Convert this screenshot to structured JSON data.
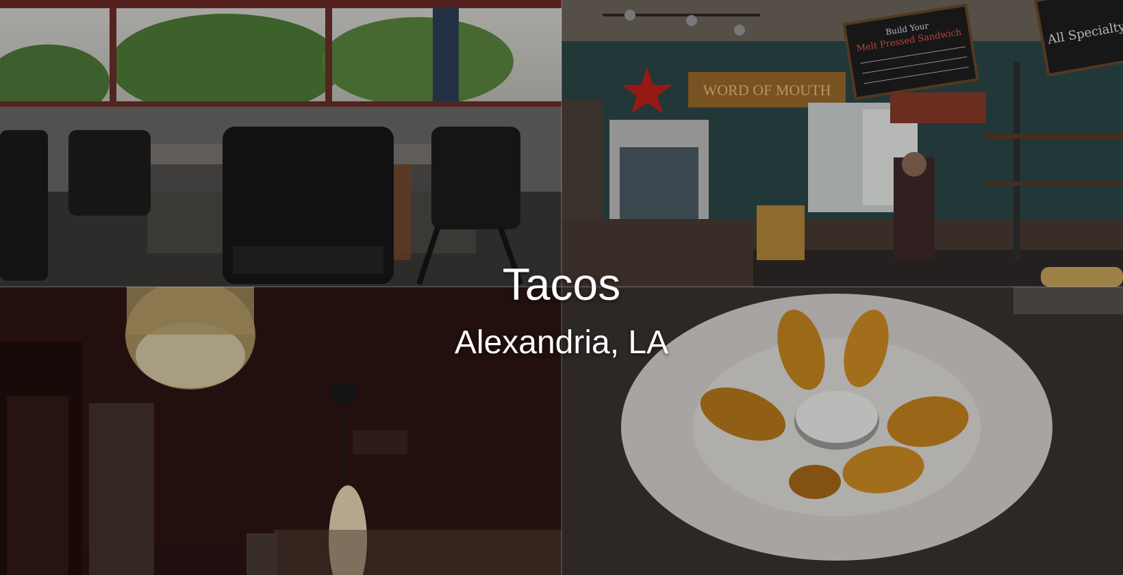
{
  "hero": {
    "title": "Tacos",
    "subtitle": "Alexandria, LA"
  },
  "photos": [
    {
      "name": "patio-dining-photo"
    },
    {
      "name": "counter-interior-photo"
    },
    {
      "name": "pendant-lights-photo"
    },
    {
      "name": "fried-plantains-plate-photo"
    }
  ],
  "photo_signage": {
    "word_of_mouth_sign": "WORD OF MOUTH",
    "menu_board_heading": "Build Your",
    "menu_board_title": "Melt Pressed Sandwich",
    "menu_board_right": "All Specialty"
  },
  "colors": {
    "title_text": "#ffffff",
    "overlay": "rgba(0,0,0,0.22)"
  }
}
